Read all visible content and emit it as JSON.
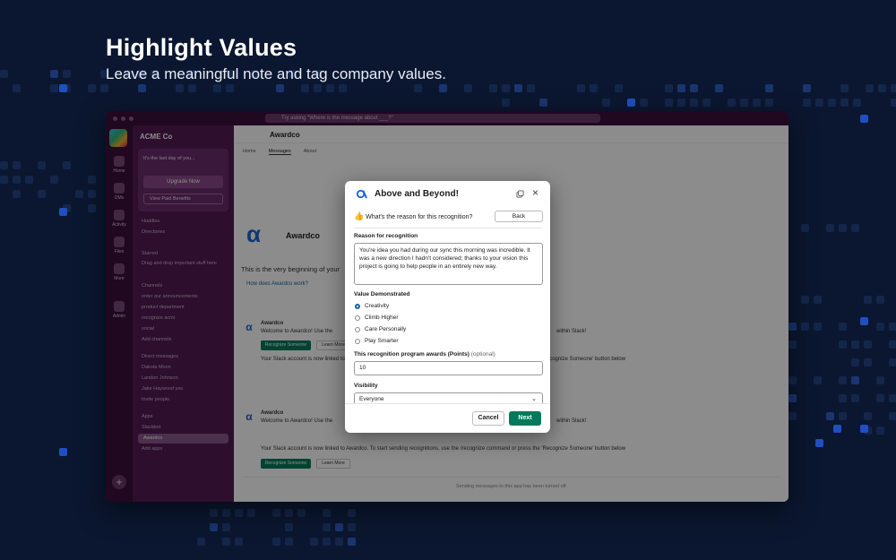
{
  "hero": {
    "title": "Highlight Values",
    "subtitle": "Leave a meaningful note and tag company values."
  },
  "app": {
    "search_placeholder": "Try asking \"Where is the message about ___?\"",
    "workspace": "ACME Co",
    "promo_text": "It's the last day of you...",
    "upgrade_label": "Upgrade Now",
    "paid_benefits_label": "View Paid Benefits",
    "rail": [
      "Home",
      "DMs",
      "Activity",
      "Files",
      "More",
      "Admin"
    ],
    "sidebar_items": [
      "Huddles",
      "Directories",
      "Starred",
      "Drag and drop important stuff here",
      "Channels",
      "enter our announcements",
      "product department",
      "recognize acmi",
      "social",
      "Add channels",
      "Direct messages",
      "Dakota Moon",
      "Landon Johnson",
      "Jake Haywood  you",
      "Invite people",
      "Apps",
      "Slackbot",
      "Awardco",
      "Add apps"
    ],
    "channel_name": "Awardco",
    "tabs": [
      "Home",
      "Messages",
      "About"
    ],
    "intro_name": "Awardco",
    "intro_text": "This is the very beginning of your",
    "intro_link": "How does Awardco work?",
    "message_author": "Awardco",
    "message_line1": "Welcome to Awardco! Use the",
    "message_line1_end": "within Slack!",
    "message_line2": "Your Slack account is now linked to Awardco. To start sending recognitions, use the /recognize command or press the 'Recognize Someone' button below",
    "recognize_label": "Recognize Someone",
    "learn_more_label": "Learn More",
    "composer_text": "Sending messages to this app has been turned off."
  },
  "modal": {
    "title": "Above and Beyond!",
    "reason_question": "What's the reason for this recognition?",
    "back_label": "Back",
    "reason_label": "Reason for recognition",
    "reason_text": "You're idea you had during our sync this morning was incredible. It was a new direction I hadn't considered; thanks to your vision this project is going to help people in an entirely new way.",
    "values_label": "Value Demonstrated",
    "values": [
      {
        "label": "Creativity",
        "selected": true
      },
      {
        "label": "Climb Higher",
        "selected": false
      },
      {
        "label": "Care Personally",
        "selected": false
      },
      {
        "label": "Play Smarter",
        "selected": false
      }
    ],
    "points_label": "This recognition program awards (Points)",
    "points_optional": "(optional)",
    "points_value": "10",
    "visibility_label": "Visibility",
    "visibility_value": "Everyone",
    "cancel_label": "Cancel",
    "next_label": "Next"
  },
  "colors": {
    "background": "#0b1730",
    "slack_purple": "#4a154b",
    "primary_green": "#007a5a",
    "awardco_blue": "#1e63d6"
  }
}
